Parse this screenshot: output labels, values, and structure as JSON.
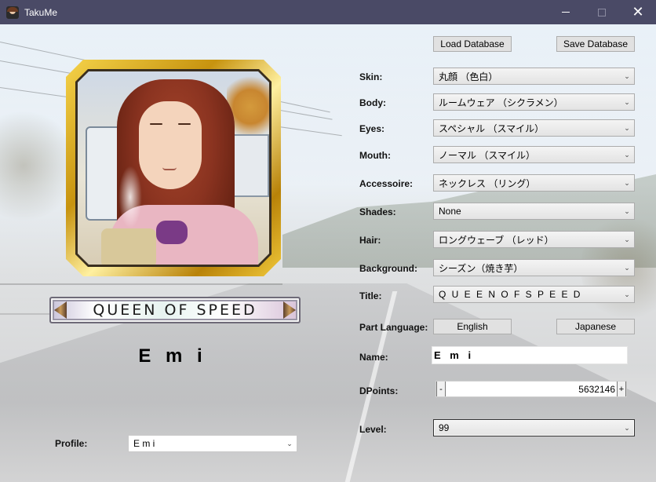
{
  "window": {
    "title": "TakuMe",
    "minimize_icon": "minimize-icon",
    "maximize_icon": "maximize-icon",
    "close_symbol": "✕"
  },
  "profile_card": {
    "title_plate": "QUEEN OF SPEED",
    "display_name": "E m i"
  },
  "toolbar": {
    "load_label": "Load Database",
    "save_label": "Save Database"
  },
  "fields": {
    "skin": {
      "label": "Skin:",
      "value": "丸顔 （色白）"
    },
    "body": {
      "label": "Body:",
      "value": "ルームウェア （シクラメン）"
    },
    "eyes": {
      "label": "Eyes:",
      "value": "スペシャル （スマイル）"
    },
    "mouth": {
      "label": "Mouth:",
      "value": "ノーマル （スマイル）"
    },
    "accessoire": {
      "label": "Accessoire:",
      "value": "ネックレス （リング）"
    },
    "shades": {
      "label": "Shades:",
      "value": "None"
    },
    "hair": {
      "label": "Hair:",
      "value": "ロングウェーブ （レッド）"
    },
    "background": {
      "label": "Background:",
      "value": "シーズン（焼き芋）"
    },
    "title": {
      "label": "Title:",
      "value": "Q U E E N  O F  S P E E D"
    }
  },
  "part_language": {
    "label": "Part Language:",
    "english_label": "English",
    "japanese_label": "Japanese"
  },
  "name_field": {
    "label": "Name:",
    "value": "E m i"
  },
  "dpoints": {
    "label": "DPoints:",
    "value": "5632146",
    "minus": "-",
    "plus": "+"
  },
  "level": {
    "label": "Level:",
    "value": "99"
  },
  "profile": {
    "label": "Profile:",
    "value": "E m i"
  },
  "colors": {
    "titlebar": "#4a4a66",
    "button_face": "#e1e1e1",
    "button_border": "#adadad"
  }
}
